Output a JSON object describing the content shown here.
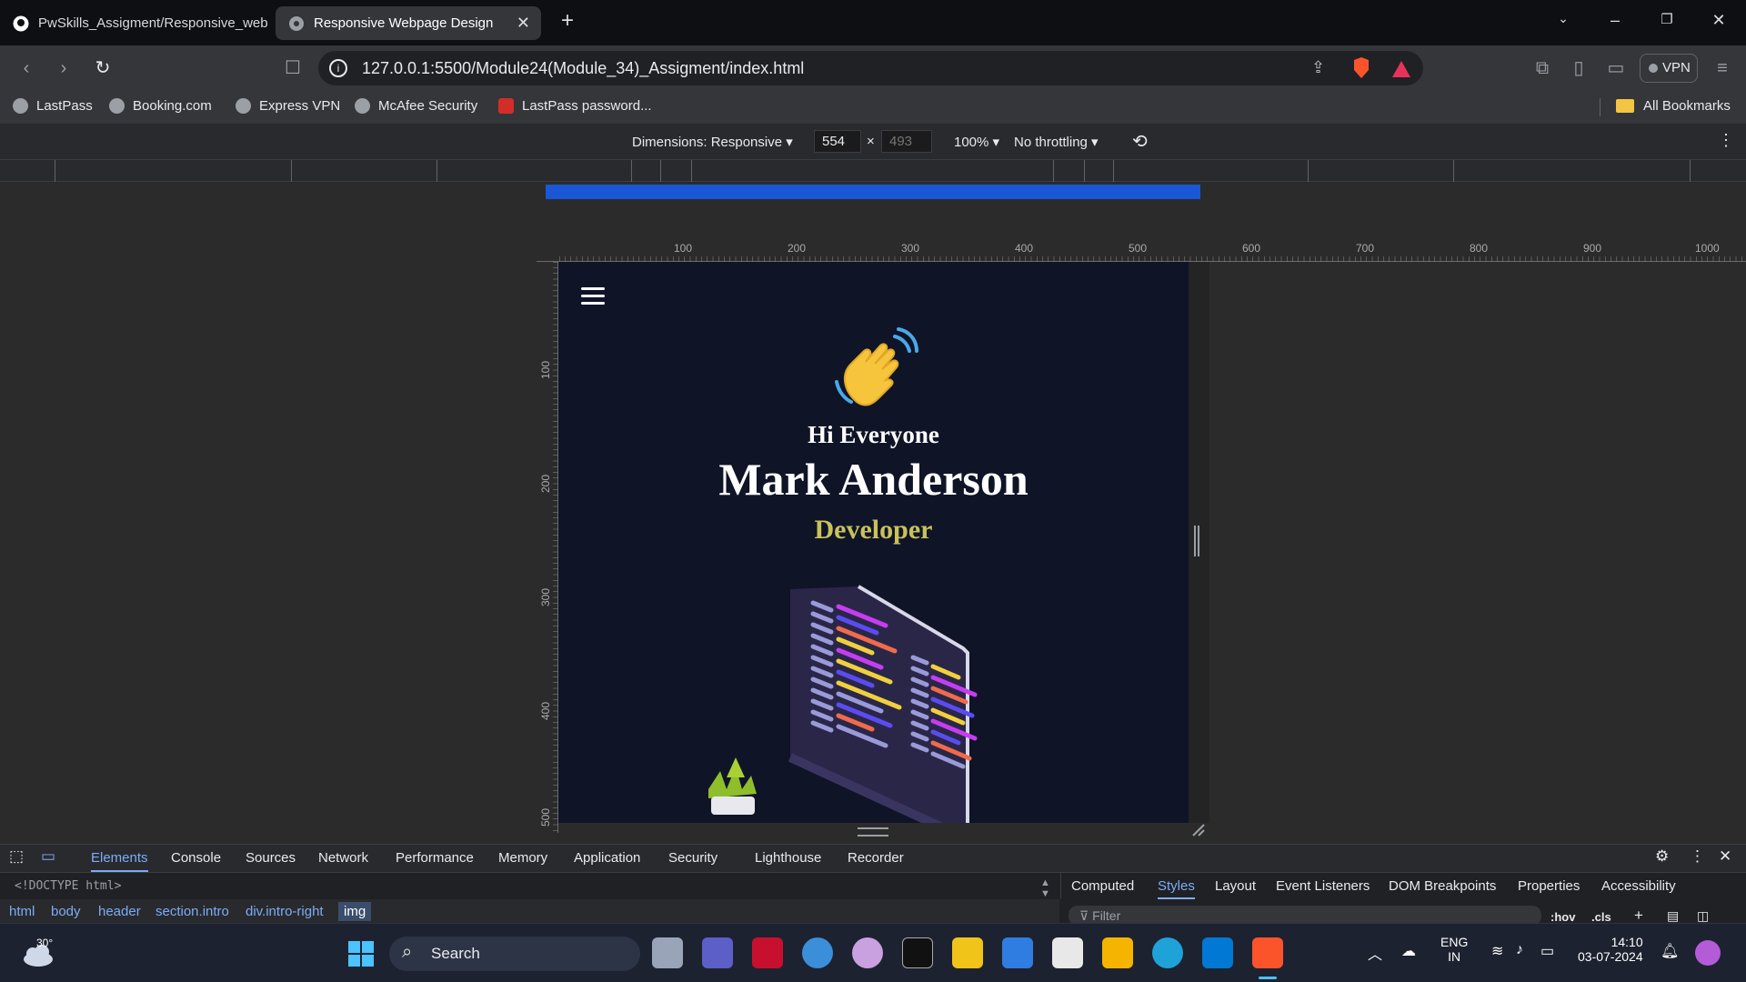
{
  "browser": {
    "tabs": [
      {
        "title": "PwSkills_Assigment/Responsive_web",
        "active": false
      },
      {
        "title": "Responsive Webpage Design",
        "active": true
      }
    ],
    "url": "127.0.0.1:5500/Module24(Module_34)_Assigment/index.html",
    "vpn_label": "VPN",
    "bookmarks": [
      "LastPass",
      "Booking.com",
      "Express VPN",
      "McAfee Security",
      "LastPass password..."
    ],
    "all_bookmarks": "All Bookmarks"
  },
  "device_toolbar": {
    "dimensions_label": "Dimensions: Responsive",
    "width": "554",
    "height_placeholder": "493",
    "times": "×",
    "zoom": "100%",
    "throttling": "No throttling"
  },
  "rulers": {
    "top": [
      "100",
      "200",
      "300",
      "400",
      "500",
      "600",
      "700",
      "800",
      "900",
      "1000"
    ],
    "left": [
      "100",
      "200",
      "300",
      "400",
      "500"
    ]
  },
  "site": {
    "greeting": "Hi Everyone",
    "name": "Mark Anderson",
    "role": "Developer",
    "colors": {
      "background": "#0f1427",
      "role": "#c9c25b"
    }
  },
  "devtools": {
    "tabs": [
      "Elements",
      "Console",
      "Sources",
      "Network",
      "Performance",
      "Memory",
      "Application",
      "Security",
      "Lighthouse",
      "Recorder"
    ],
    "active_tab": "Elements",
    "doctype": "<!DOCTYPE html>",
    "breadcrumbs": [
      "html",
      "body",
      "header",
      "section.intro",
      "div.intro-right",
      "img"
    ],
    "side_tabs": [
      "Computed",
      "Styles",
      "Layout",
      "Event Listeners",
      "DOM Breakpoints",
      "Properties",
      "Accessibility"
    ],
    "active_side_tab": "Styles",
    "filter_placeholder": "Filter",
    "hov": ":hov",
    "cls": ".cls"
  },
  "taskbar": {
    "weather": "30°",
    "search": "Search",
    "lang_top": "ENG",
    "lang_bottom": "IN",
    "time": "14:10",
    "date": "03-07-2024"
  }
}
